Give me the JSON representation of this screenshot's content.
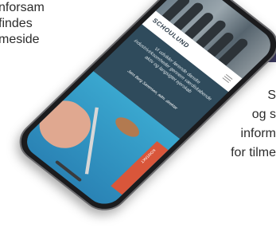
{
  "left_text": {
    "line1": "nforsam",
    "line2": "findes",
    "line3": "meside"
  },
  "right_text": {
    "line1": "S",
    "line2": "og s",
    "line3": "inform",
    "line4": "for tilme"
  },
  "phone": {
    "logo": "SCHOULUND",
    "quote": "Vi udvikler førende danske industrivirksomheder gennem værdiskabende aktiv og langsigtet ejerskab",
    "author": "Jens Berg Sørensen, adm. direktør",
    "side_tab": "KONTAKT"
  },
  "colors": {
    "screen_bg": "#2f4b5c",
    "accent_tab": "#d9563a",
    "purple_block": "#3d3a63"
  }
}
